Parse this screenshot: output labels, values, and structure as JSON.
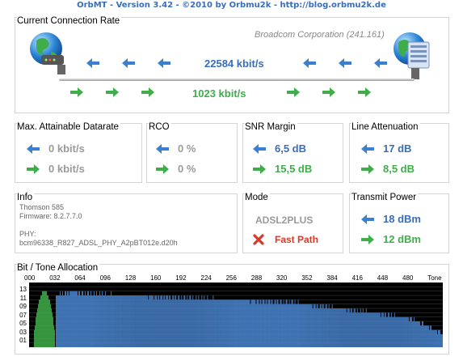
{
  "app": {
    "title": "OrbMT - Version 3.42 - ©2010 by Orbmu2k - http://blog.orbmu2k.de"
  },
  "connection": {
    "title": "Current Connection Rate",
    "chipset": "Broadcom Corporation (241.161)",
    "downstream": "22584 kbit/s",
    "upstream": "1023 kbit/s"
  },
  "attainable": {
    "title": "Max. Attainable Datarate",
    "down": "0 kbit/s",
    "up": "0 kbit/s"
  },
  "rco": {
    "title": "RCO",
    "down": "0 %",
    "up": "0 %"
  },
  "snr": {
    "title": "SNR Margin",
    "down": "6,5 dB",
    "up": "15,5 dB"
  },
  "attenuation": {
    "title": "Line Attenuation",
    "down": "17 dB",
    "up": "8,5 dB"
  },
  "info": {
    "title": "Info",
    "device": "Thomson 585",
    "firmware": "Firmware: 8.2.7.7.0",
    "phy_label": "PHY:",
    "phy_value": "bcm96338_R827_ADSL_PHY_A2pBT012e.d20h"
  },
  "mode": {
    "title": "Mode",
    "standard": "ADSL2PLUS",
    "path": "Fast Path"
  },
  "transmit": {
    "title": "Transmit Power",
    "down": "18 dBm",
    "up": "12 dBm"
  },
  "tones": {
    "title": "Bit / Tone Allocation",
    "x_ticks": [
      "000",
      "032",
      "064",
      "096",
      "128",
      "160",
      "192",
      "224",
      "256",
      "288",
      "320",
      "352",
      "384",
      "416",
      "448",
      "480",
      "Tone"
    ],
    "y_ticks": [
      "13",
      "11",
      "09",
      "07",
      "05",
      "03",
      "01"
    ]
  },
  "chart_data": {
    "type": "bar",
    "title": "Bit / Tone Allocation",
    "xlabel": "Tone",
    "ylabel": "",
    "xlim": [
      0,
      511
    ],
    "ylim": [
      0,
      15
    ],
    "series": [
      {
        "color": "#3fae49",
        "ranges": [
          [
            6,
            31
          ]
        ],
        "profile": "upstream"
      },
      {
        "color": "#4a86d0",
        "ranges": [
          [
            33,
            511
          ]
        ],
        "profile": "downstream"
      }
    ]
  },
  "colors": {
    "accent": "#3a6db8",
    "upstream": "#3fae49",
    "downstream_bar": "#4a86d0",
    "chart_bg": "#000000"
  }
}
